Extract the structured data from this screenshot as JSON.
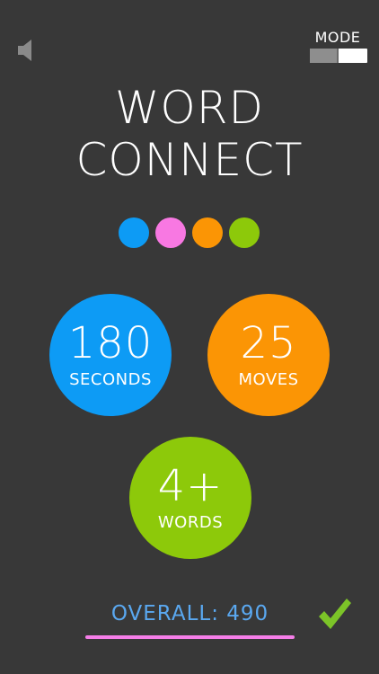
{
  "header": {
    "sound_icon": "speaker-icon",
    "mode_label": "MODE",
    "mode_toggle": {
      "state": "right"
    }
  },
  "title": {
    "line1": "WORD",
    "line2": "CONNECT"
  },
  "colors": {
    "background": "#383838",
    "blue": "#0d9bf5",
    "pink": "#f878e2",
    "orange": "#fb9505",
    "green": "#8dc90a",
    "overall_text": "#5aa8f0",
    "overall_line": "#f57ee8"
  },
  "game_modes": [
    {
      "value": "180",
      "unit": "SECONDS",
      "color": "#0d9bf5"
    },
    {
      "value": "25",
      "unit": "MOVES",
      "color": "#fb9505"
    },
    {
      "value": "4+",
      "unit": "WORDS",
      "color": "#8dc90a"
    }
  ],
  "footer": {
    "overall_label": "OVERALL: 490",
    "confirm_icon": "checkmark-icon"
  }
}
